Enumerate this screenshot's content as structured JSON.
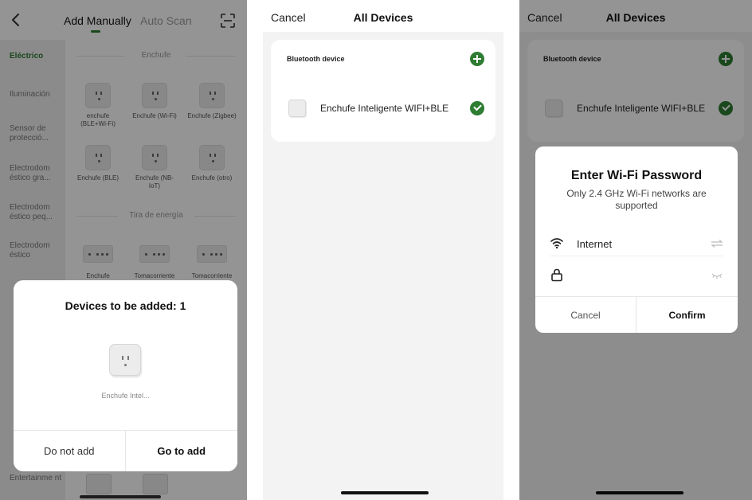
{
  "colors": {
    "accent": "#2e7d32",
    "overlay": "rgba(0,0,0,0.42)"
  },
  "screen1": {
    "tabs": {
      "manual": "Add Manually",
      "auto": "Auto Scan"
    },
    "categories": [
      "Eléctrico",
      "Iluminación",
      "Sensor de protecció...",
      "Electrodom éstico gra...",
      "Electrodom éstico peq...",
      "Electrodom éstico",
      "Entertainme nt"
    ],
    "sections": {
      "plug": "Enchufe",
      "strip": "Tira de energía"
    },
    "plug_devices": [
      "enchufe (BLE+Wi-Fi)",
      "Enchufe (Wi-Fi)",
      "Enchufe (Zigbee)",
      "Enchufe (BLE)",
      "Enchufe (NB-IoT)",
      "Enchufe (otro)"
    ],
    "strip_devices": [
      "Enchufe",
      "Tomacorriente",
      "Tomacorriente"
    ],
    "sheet": {
      "title": "Devices to be added: 1",
      "device_name": "Enchufe Intel...",
      "do_not_add": "Do not add",
      "go_to_add": "Go to add"
    }
  },
  "screen2": {
    "cancel": "Cancel",
    "title": "All Devices",
    "section_label": "Bluetooth device",
    "device_name": "Enchufe Inteligente WIFI+BLE"
  },
  "screen3": {
    "cancel": "Cancel",
    "title": "All Devices",
    "section_label": "Bluetooth device",
    "device_name": "Enchufe Inteligente WIFI+BLE",
    "dialog": {
      "title": "Enter Wi-Fi Password",
      "subtitle": "Only 2.4 GHz Wi-Fi networks are supported",
      "network": "Internet",
      "password_placeholder": "",
      "cancel": "Cancel",
      "confirm": "Confirm"
    }
  }
}
